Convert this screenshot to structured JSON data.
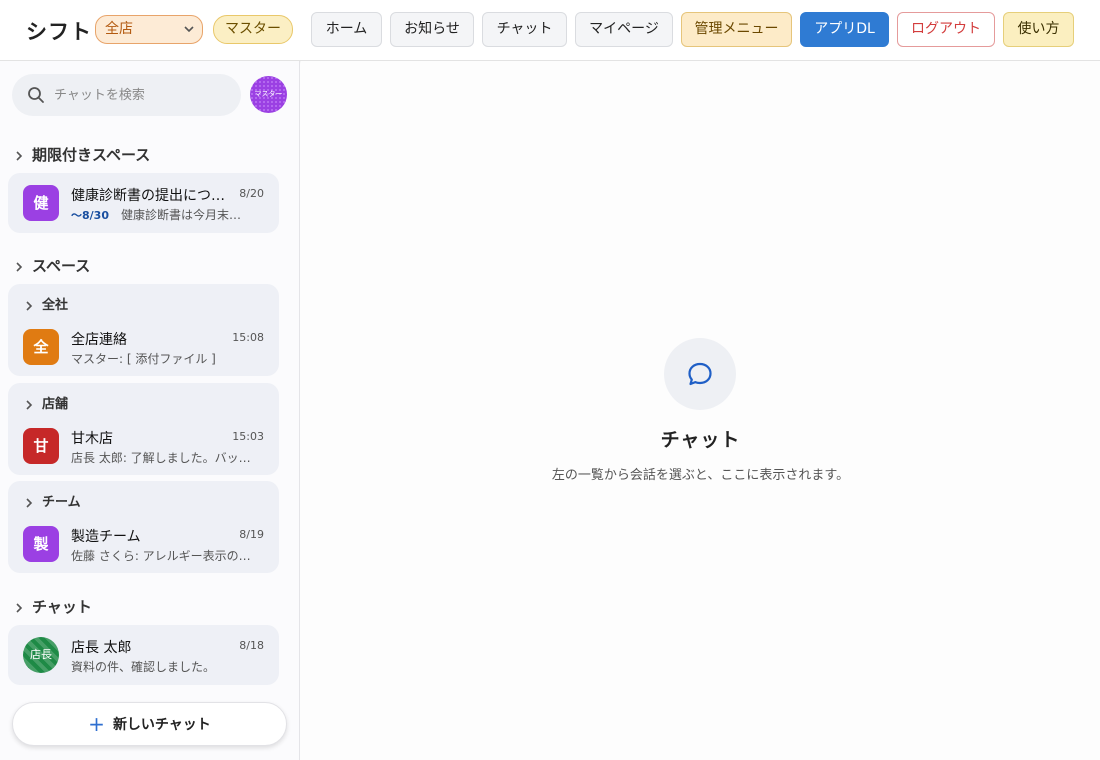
{
  "header": {
    "app_title": "シフト",
    "store_select": "全店",
    "role_badge": "マスター",
    "nav": {
      "home": "ホーム",
      "notice": "お知らせ",
      "chat": "チャット",
      "mypage": "マイページ",
      "admin": "管理メニュー",
      "app_dl": "アプリDL",
      "logout": "ログアウト",
      "help": "使い方"
    }
  },
  "sidebar": {
    "search_placeholder": "チャットを検索",
    "user_avatar_label": "マスター",
    "sections": {
      "timed_spaces": "期限付きスペース",
      "spaces": "スペース",
      "chats": "チャット"
    },
    "timed_space_item": {
      "icon": "健",
      "name": "健康診断書の提出につ…",
      "time": "8/20",
      "deadline": "〜8/30",
      "preview": "健康診断書は今月末…"
    },
    "groups": [
      {
        "label": "全社",
        "item": {
          "icon": "全",
          "name": "全店連絡",
          "time": "15:08",
          "preview": "マスター: [ 添付ファイル ]"
        }
      },
      {
        "label": "店舗",
        "item": {
          "icon": "甘",
          "name": "甘木店",
          "time": "15:03",
          "preview": "店長 太郎: 了解しました。バッ…"
        }
      },
      {
        "label": "チーム",
        "item": {
          "icon": "製",
          "name": "製造チーム",
          "time": "8/19",
          "preview": "佐藤 さくら: アレルギー表示の…"
        }
      }
    ],
    "dm_item": {
      "icon": "店長",
      "name": "店長 太郎",
      "time": "8/18",
      "preview": "資料の件、確認しました。"
    },
    "new_chat_label": "新しいチャット"
  },
  "main": {
    "empty_title": "チャット",
    "empty_desc": "左の一覧から会話を選ぶと、ここに表示されます。"
  },
  "colors": {
    "accent_blue": "#2f7bd3",
    "timed_icon": "#9b40e3",
    "company_icon": "#e07b12",
    "store_icon": "#c62828",
    "team_icon": "#9b40e3",
    "dm_icon": "#1e8a46"
  }
}
